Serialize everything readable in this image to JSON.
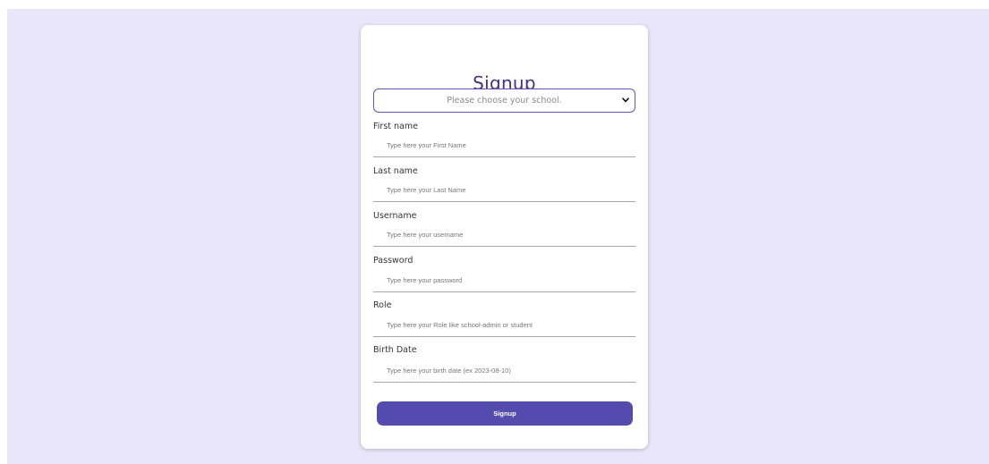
{
  "form": {
    "title": "Signup",
    "school_select": {
      "selected": "Please choose your school."
    },
    "fields": [
      {
        "label": "First name",
        "placeholder": "Type here your First Name"
      },
      {
        "label": "Last name",
        "placeholder": "Type here your Last Name"
      },
      {
        "label": "Username",
        "placeholder": "Type here your username"
      },
      {
        "label": "Password",
        "placeholder": "Type here your password"
      },
      {
        "label": "Role",
        "placeholder": "Type here your Role like school-admin or student"
      },
      {
        "label": "Birth Date",
        "placeholder": "Type here your birth date (ex 2023-08-10)"
      }
    ],
    "submit_label": "Signup"
  },
  "colors": {
    "page_background": "#e8e6f8",
    "card_background": "#ffffff",
    "title": "#4a2f7f",
    "accent": "#6752b8",
    "button": "#534bae"
  },
  "icons": {
    "select_chevron": "chevron-down-icon"
  }
}
